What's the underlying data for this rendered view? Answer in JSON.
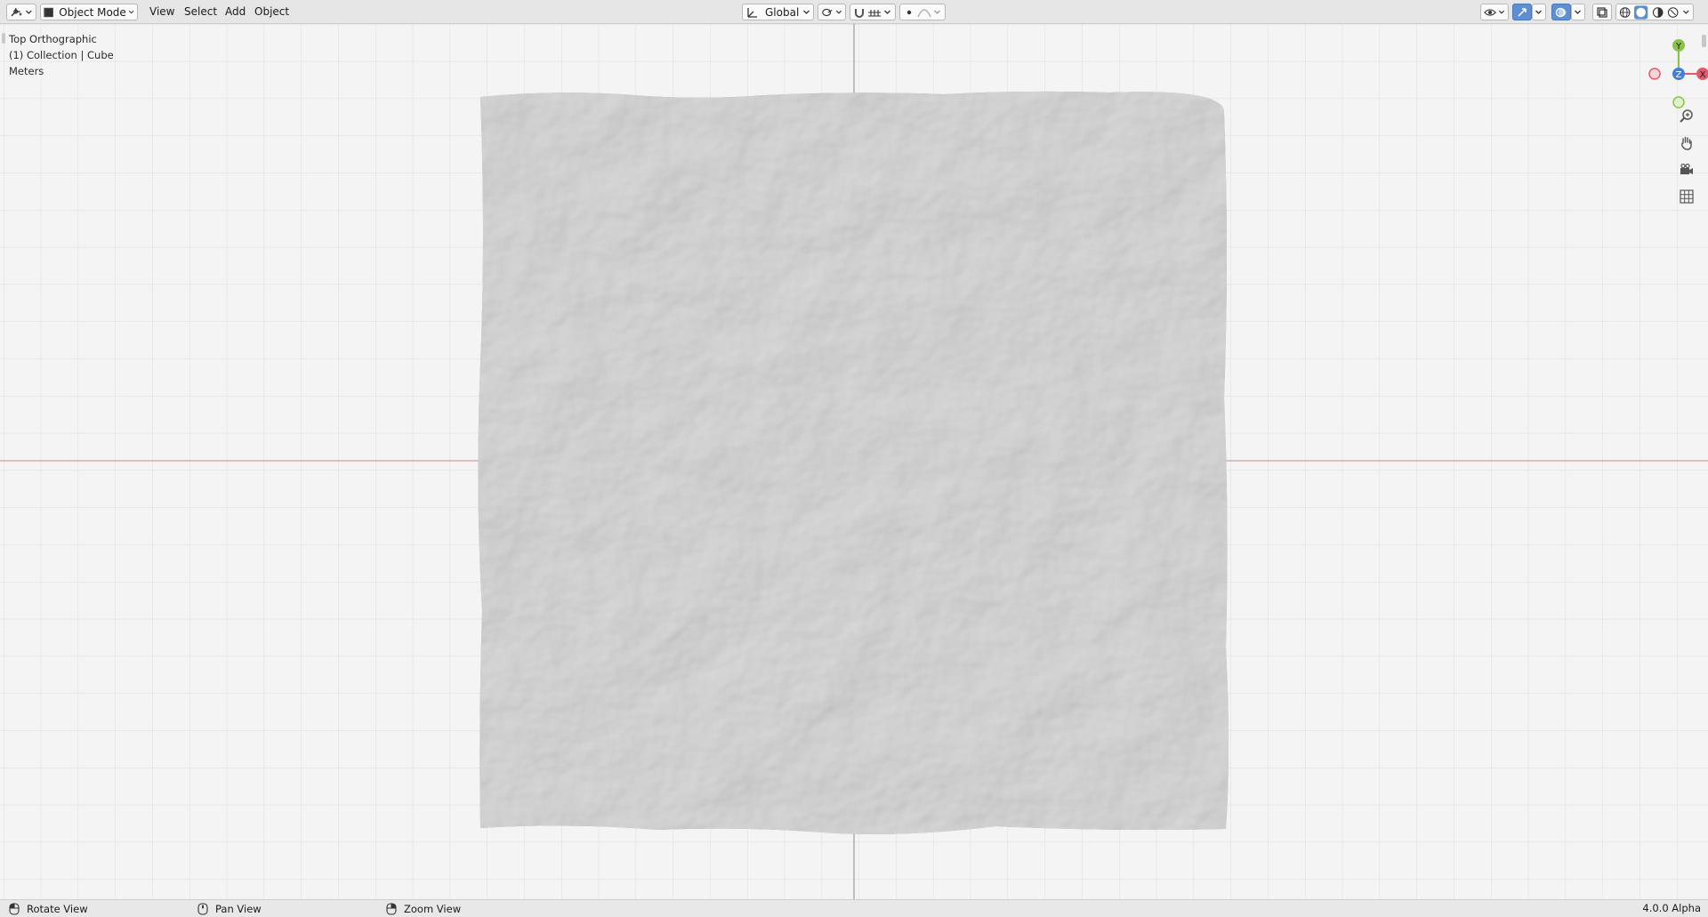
{
  "header": {
    "menu": [
      "View",
      "Select",
      "Add",
      "Object"
    ],
    "mode_label": "Object Mode",
    "orientation_label": "Global"
  },
  "viewport": {
    "view_name": "Top Orthographic",
    "collection_info": "(1) Collection | Cube",
    "units": "Meters",
    "gizmo": {
      "y": "Y",
      "z": "Z",
      "x": "X"
    }
  },
  "status": {
    "rotate": "Rotate View",
    "pan": "Pan View",
    "zoom": "Zoom View",
    "version": "4.0.0 Alpha"
  },
  "colors": {
    "x_axis": "#e35a6b",
    "y_axis": "#8bc34a",
    "z_axis": "#3f7fde",
    "active_button": "#5d8fd1"
  }
}
